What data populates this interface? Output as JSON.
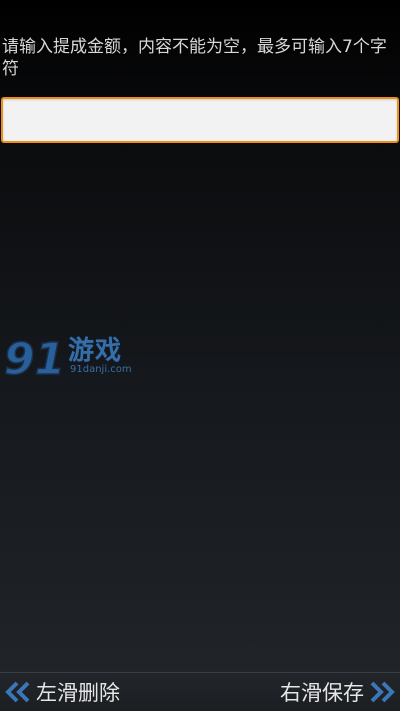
{
  "form": {
    "prompt": "请输入提成金额，内容不能为空，最多可输入7个字符",
    "amount_value": ""
  },
  "watermark": {
    "logo_number": "91",
    "brand": "游戏",
    "url": "91danji.com"
  },
  "bottom_bar": {
    "delete_label": "左滑删除",
    "save_label": "右滑保存",
    "left_icon": "double-chevron-left-icon",
    "right_icon": "double-chevron-right-icon",
    "chevron_color": "#3b77b8"
  },
  "colors": {
    "input_border": "#f08c1a",
    "watermark": "#3d7fc0"
  }
}
